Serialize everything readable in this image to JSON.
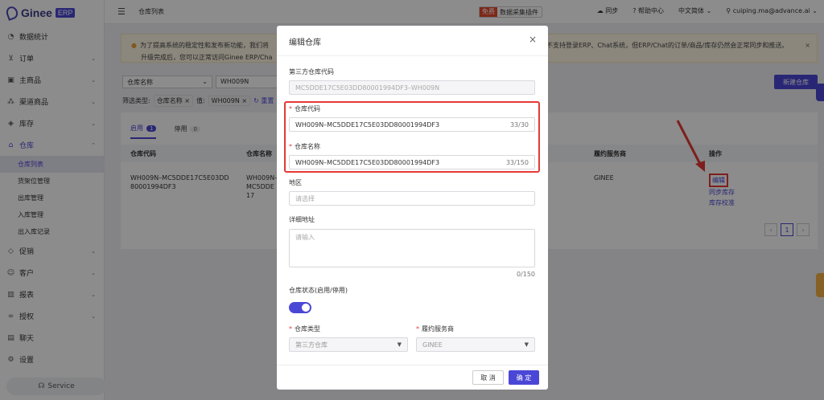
{
  "app": {
    "logo_text": "Ginee",
    "logo_badge": "ERP"
  },
  "sidebar": {
    "items": [
      {
        "label": "数据统计",
        "icon": "dashboard-icon"
      },
      {
        "label": "订单",
        "icon": "cart-icon"
      },
      {
        "label": "主商品",
        "icon": "bag-icon"
      },
      {
        "label": "渠道商品",
        "icon": "channel-icon"
      },
      {
        "label": "库存",
        "icon": "box-icon"
      },
      {
        "label": "仓库",
        "icon": "warehouse-icon"
      }
    ],
    "sub_items": [
      "仓库列表",
      "货架位管理",
      "出库管理",
      "入库管理",
      "出入库记录"
    ],
    "items_after": [
      {
        "label": "促销",
        "icon": "tag-icon"
      },
      {
        "label": "客户",
        "icon": "users-icon"
      },
      {
        "label": "报表",
        "icon": "chart-icon"
      },
      {
        "label": "授权",
        "icon": "link-icon"
      },
      {
        "label": "聊天",
        "icon": "chat-icon"
      },
      {
        "label": "设置",
        "icon": "gear-icon"
      }
    ],
    "service_label": "Service"
  },
  "topbar": {
    "crumb": "仓库列表",
    "plugin_free": "免费",
    "plugin_label": "数据采集插件",
    "sync": "同步",
    "help": "帮助中心",
    "language": "中文简体",
    "user": "cuiping.ma@advance.ai"
  },
  "notice": {
    "line1": "为了提高系统的稳定性和发布新功能，我们将",
    "line1_right": "不支持登录ERP、Chat系统，但ERP/Chat的订单/商品/库存仍然会正常同步和推送。",
    "line2": "升级完成后，您可以正常访问Ginee ERP/Cha"
  },
  "filters": {
    "field": "仓库名称",
    "value": "WH009N",
    "type_label": "筛选类型:",
    "tag1": "仓库名称 ×",
    "value_label": "值:",
    "tag2": "WH009N ×",
    "reset": "重置",
    "new_button": "新建仓库"
  },
  "tabs": [
    {
      "label": "启用",
      "count": "1"
    },
    {
      "label": "停用",
      "count": "0"
    }
  ],
  "table": {
    "headers": [
      "仓库代码",
      "仓库名称",
      "履约服务商",
      "操作"
    ],
    "row": {
      "code": "WH009N–MC5DDE17C5E03DD80001994DF3",
      "name": "WH009N–MC5DDE17",
      "provider": "GINEE",
      "ops": [
        "编辑",
        "同步库存",
        "库存校准"
      ]
    },
    "page": "1"
  },
  "modal": {
    "title": "编辑仓库",
    "third_party_code_label": "第三方仓库代码",
    "third_party_code_value": "MC5DDE17C5E03DD80001994DF3–WH009N",
    "code_label": "仓库代码",
    "code_value": "WH009N–MC5DDE17C5E03DD80001994DF3",
    "code_count": "33/30",
    "name_label": "仓库名称",
    "name_value": "WH009N–MC5DDE17C5E03DD80001994DF3",
    "name_count": "33/150",
    "region_label": "地区",
    "region_placeholder": "请选择",
    "address_label": "详细地址",
    "address_placeholder": "请输入",
    "address_count": "0/150",
    "status_label": "仓库状态(启用/停用)",
    "type_label": "仓库类型",
    "type_value": "第三方仓库",
    "provider_label": "履约服务商",
    "provider_value": "GINEE",
    "cancel": "取 消",
    "confirm": "确 定"
  },
  "colors": {
    "accent": "#4b47d6",
    "highlight": "#e53935"
  }
}
